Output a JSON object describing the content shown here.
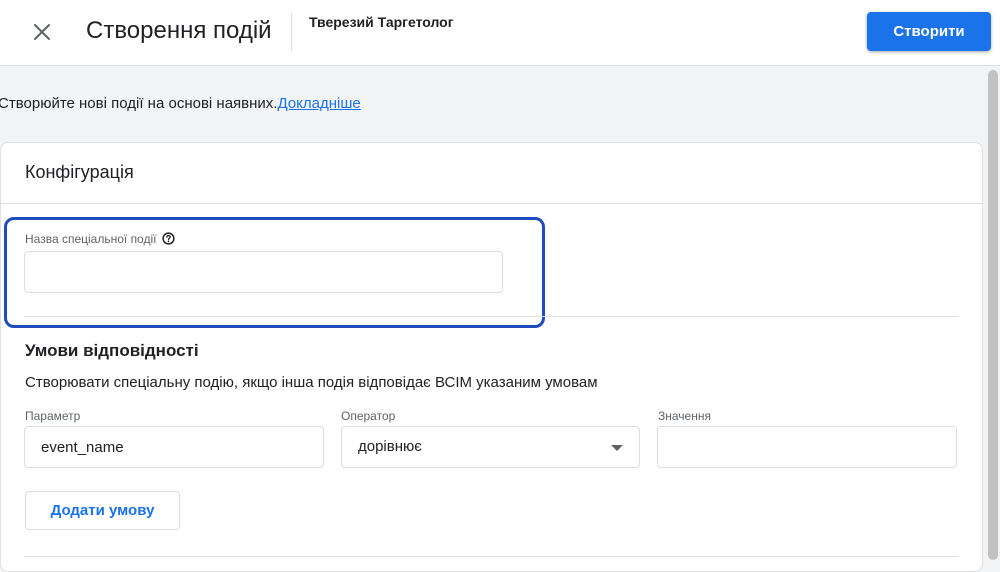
{
  "header": {
    "title": "Створення подій",
    "property": "Тверезий Таргетолог",
    "create_label": "Створити",
    "close_icon": "close-icon"
  },
  "intro": {
    "text": "Створюйте нові події на основі наявних.",
    "link": "Докладніше"
  },
  "config": {
    "title": "Конфігурація",
    "name_label": "Назва спеціальної події",
    "name_value": "",
    "help_icon": "help-icon"
  },
  "conditions": {
    "title": "Умови відповідності",
    "description": "Створювати спеціальну подію, якщо інша подія відповідає ВСІМ указаним умовам",
    "param_label": "Параметр",
    "param_value": "event_name",
    "operator_label": "Оператор",
    "operator_value": "дорівнює",
    "value_label": "Значення",
    "value_value": "",
    "add_label": "Додати умову"
  },
  "colors": {
    "accent": "#1a73e8",
    "highlight": "#1e4bbd"
  }
}
